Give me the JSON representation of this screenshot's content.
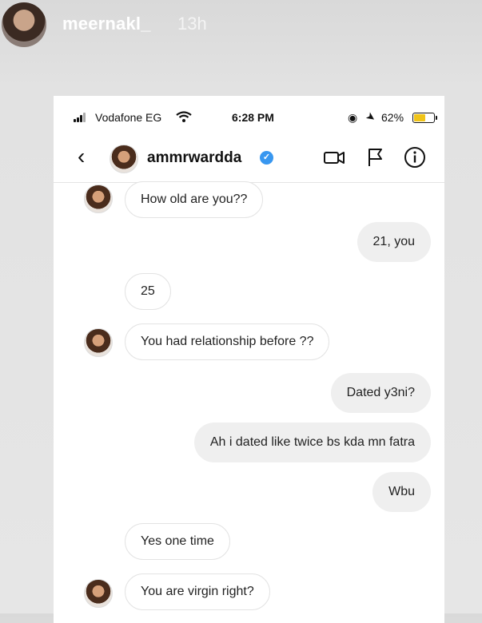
{
  "story": {
    "username": "meernakl_",
    "time": "13h"
  },
  "status_bar": {
    "carrier": "Vodafone EG",
    "time": "6:28 PM",
    "battery": "62%",
    "battery_level": 0.62,
    "battery_color": "#f0c419"
  },
  "chat_header": {
    "username": "ammrwardda",
    "verified_color": "#3897f0",
    "icons": [
      "chevron-left-icon",
      "video-call-icon",
      "flag-icon",
      "info-icon"
    ]
  },
  "messages": [
    {
      "from": "them",
      "text": "How old are you??",
      "avatar": true
    },
    {
      "from": "me",
      "text": "21, you"
    },
    {
      "from": "them",
      "text": "25",
      "avatar": false
    },
    {
      "from": "them",
      "text": "You had relationship before ??",
      "avatar": true
    },
    {
      "from": "me",
      "text": "Dated y3ni?"
    },
    {
      "from": "me",
      "text": "Ah i dated like twice bs kda mn fatra"
    },
    {
      "from": "me",
      "text": "Wbu"
    },
    {
      "from": "them",
      "text": "Yes one time",
      "avatar": false
    },
    {
      "from": "them",
      "text": "You are virgin right?",
      "avatar": true
    }
  ]
}
